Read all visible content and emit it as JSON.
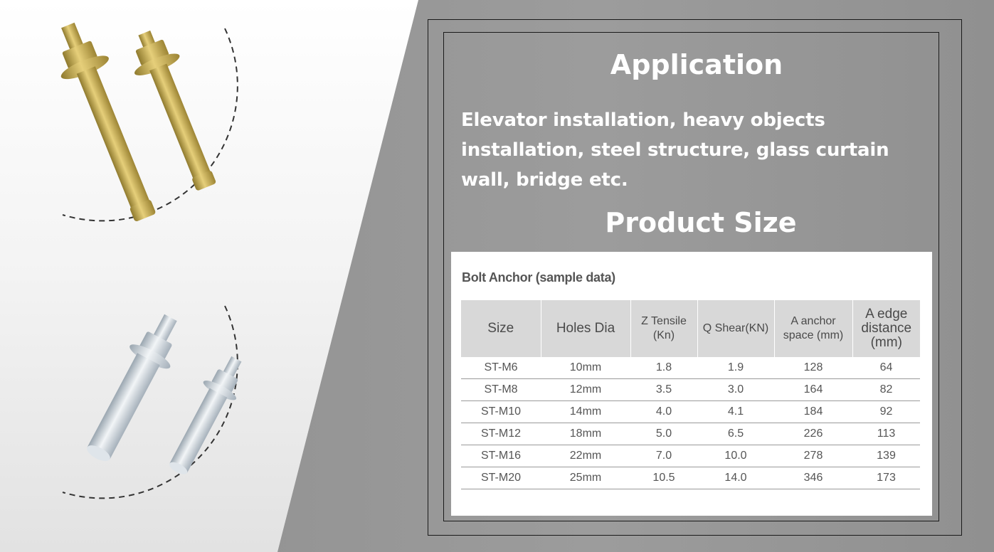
{
  "application": {
    "title": "Application",
    "text": "Elevator installation, heavy objects installation, steel structure, glass curtain wall, bridge etc."
  },
  "product_size": {
    "title": "Product Size"
  },
  "table": {
    "caption": "Bolt Anchor (sample data)",
    "headers": [
      "Size",
      "Holes Dia",
      "Z Tensile (Kn)",
      "Q Shear(KN)",
      "A anchor space (mm)",
      "A edge distance (mm)"
    ],
    "rows": [
      [
        "ST-M6",
        "10mm",
        "1.8",
        "1.9",
        "128",
        "64"
      ],
      [
        "ST-M8",
        "12mm",
        "3.5",
        "3.0",
        "164",
        "82"
      ],
      [
        "ST-M10",
        "14mm",
        "4.0",
        "4.1",
        "184",
        "92"
      ],
      [
        "ST-M12",
        "18mm",
        "5.0",
        "6.5",
        "226",
        "113"
      ],
      [
        "ST-M16",
        "22mm",
        "7.0",
        "10.0",
        "278",
        "139"
      ],
      [
        "ST-M20",
        "25mm",
        "10.5",
        "14.0",
        "346",
        "173"
      ]
    ]
  },
  "colors": {
    "bolt_gold": "#c9a94a",
    "bolt_silver": "#cfd6dc",
    "header_bg": "#d8d8d8"
  }
}
